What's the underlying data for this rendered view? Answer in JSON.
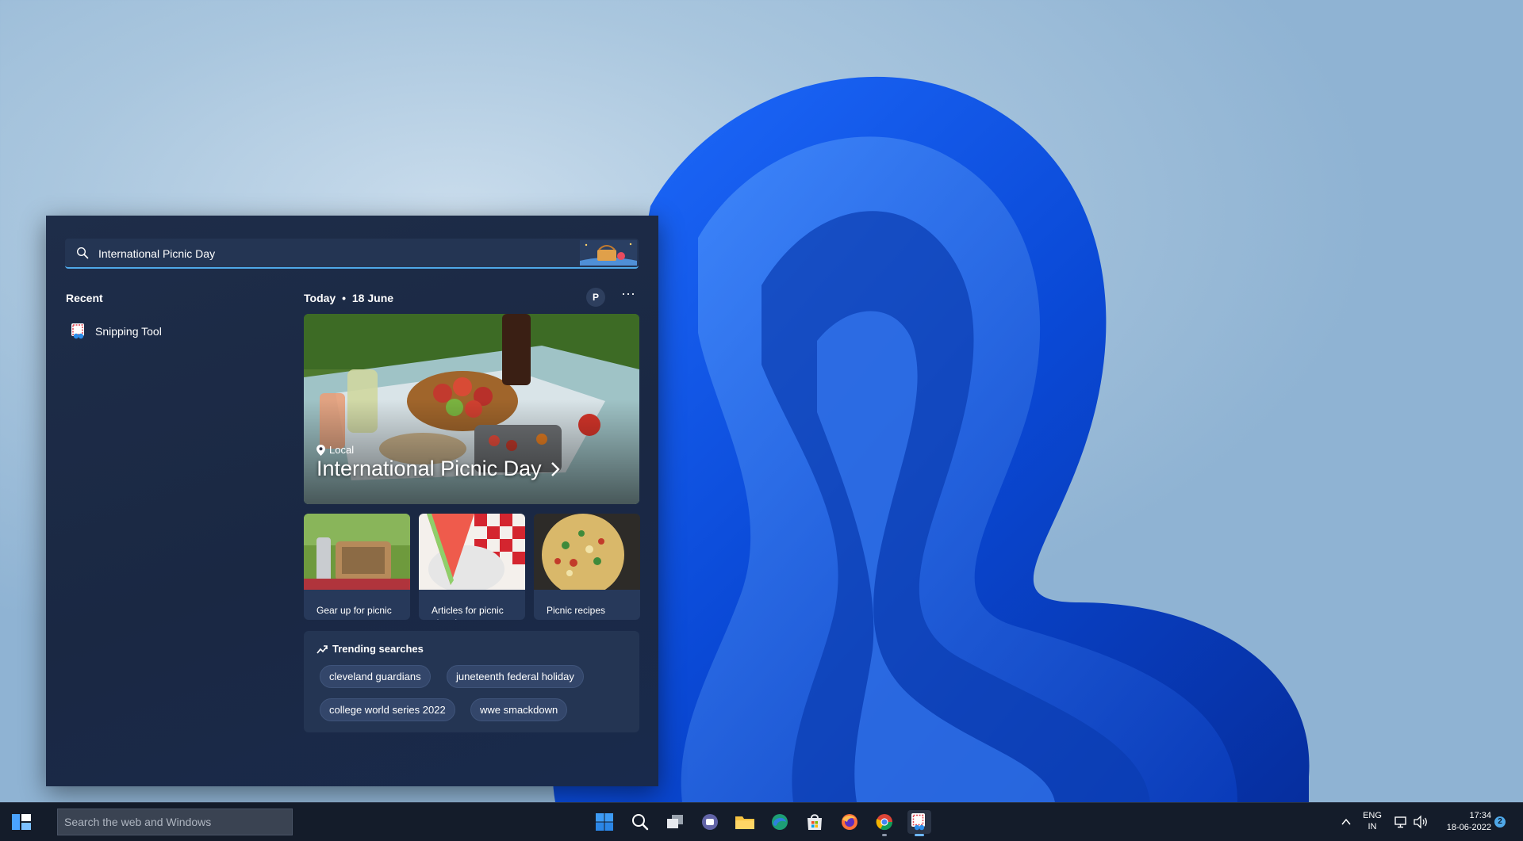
{
  "search": {
    "query": "International Picnic Day"
  },
  "recent": {
    "heading": "Recent",
    "items": [
      {
        "label": "Snipping Tool",
        "icon": "snipping-tool-icon"
      }
    ]
  },
  "today": {
    "label": "Today",
    "separator": "•",
    "date": "18 June",
    "profile_initial": "P",
    "more": "···"
  },
  "hero": {
    "location_label": "Local",
    "title": "International Picnic Day"
  },
  "cards": [
    {
      "caption": "Gear up for picnic season"
    },
    {
      "caption": "Articles for picnic planning"
    },
    {
      "caption": "Picnic recipes"
    }
  ],
  "trending": {
    "heading": "Trending searches",
    "pills": [
      "cleveland guardians",
      "juneteenth federal holiday",
      "college world series 2022",
      "wwe smackdown"
    ]
  },
  "taskbar": {
    "search_placeholder": "Search the web and Windows",
    "apps": [
      "windows-start-icon",
      "search-icon",
      "task-view-icon",
      "teams-chat-icon",
      "file-explorer-icon",
      "edge-icon",
      "microsoft-store-icon",
      "firefox-icon",
      "chrome-icon",
      "snipping-tool-icon"
    ],
    "language_line1": "ENG",
    "language_line2": "IN",
    "time": "17:34",
    "date": "18-06-2022",
    "notification_count": "2"
  },
  "colors": {
    "accent": "#4fa8e8",
    "panel_bg": "#1e2d49",
    "taskbar_bg": "#141c2a"
  }
}
